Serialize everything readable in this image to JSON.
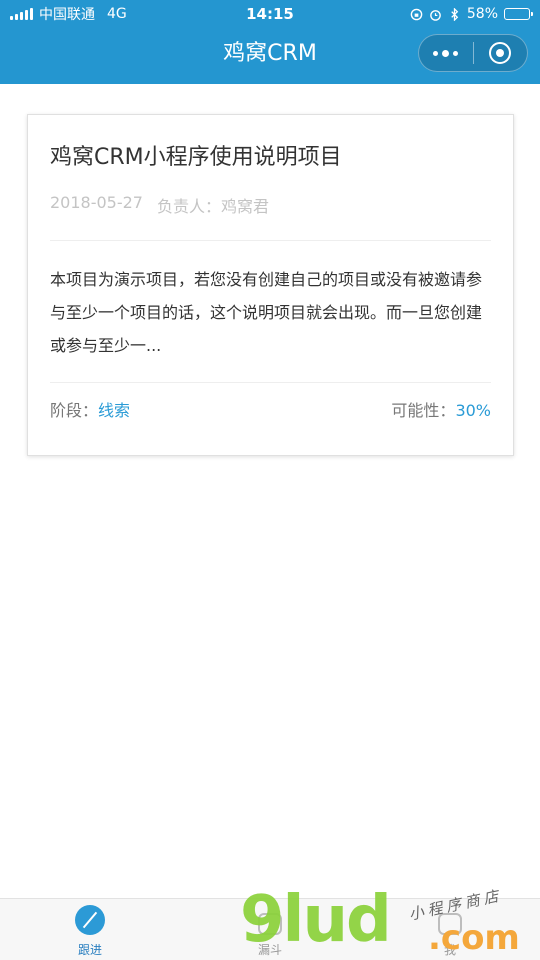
{
  "status_bar": {
    "carrier": "中国联通",
    "network": "4G",
    "time": "14:15",
    "battery": "58%",
    "battery_level": 0.58
  },
  "nav": {
    "title": "鸡窝CRM"
  },
  "project": {
    "title": "鸡窝CRM小程序使用说明项目",
    "date": "2018-05-27",
    "owner_label": "负责人：",
    "owner": "鸡窝君",
    "description": "本项目为演示项目，若您没有创建自己的项目或没有被邀请参与至少一个项目的话，这个说明项目就会出现。而一旦您创建或参与至少一...",
    "stage_label": "阶段：",
    "stage": "线索",
    "probability_label": "可能性：",
    "probability": "30%"
  },
  "tabs": [
    {
      "label": "跟进",
      "icon": "compass-icon",
      "active": true
    },
    {
      "label": "漏斗",
      "icon": "funnel-icon",
      "active": false
    },
    {
      "label": "我",
      "icon": "user-icon",
      "active": false
    }
  ],
  "watermark": {
    "main": "9lud",
    "domain": ".com",
    "script": "小程序商店"
  },
  "colors": {
    "brand": "#2496d0",
    "accent": "#2a9bd6"
  }
}
